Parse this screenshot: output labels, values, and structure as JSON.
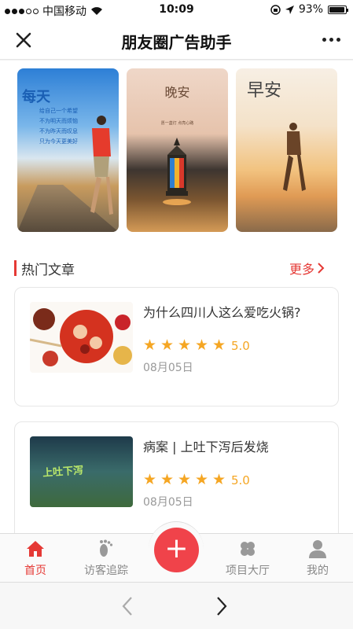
{
  "status": {
    "carrier": "中国移动",
    "time": "10:09",
    "battery": "93%",
    "battery_fraction": 0.93
  },
  "header": {
    "title": "朋友圈广告助手"
  },
  "posters": [
    {
      "name": "poster-morning-run",
      "big": "每天",
      "lines": [
        "给自己一个希望",
        "不为明天而烦恼",
        "不为昨天而叹息",
        "只为今天更美好"
      ]
    },
    {
      "name": "poster-good-night",
      "title": "晚安",
      "sub": "愿一盏灯 点亮心路"
    },
    {
      "name": "poster-good-morning",
      "title": "早安"
    }
  ],
  "section": {
    "title": "热门文章",
    "more": "更多"
  },
  "articles": [
    {
      "title": "为什么四川人这么爱吃火锅?",
      "rating": "5.0",
      "stars": 5,
      "date": "08月05日"
    },
    {
      "title": "病案 | 上吐下泻后发烧",
      "rating": "5.0",
      "stars": 5,
      "date": "08月05日",
      "thumb_text": "上吐下泻"
    }
  ],
  "tabs": [
    {
      "label": "首页",
      "icon": "home-icon",
      "active": true
    },
    {
      "label": "访客追踪",
      "icon": "footprint-icon"
    },
    {
      "label": "项目大厅",
      "icon": "clover-icon"
    },
    {
      "label": "我的",
      "icon": "person-icon"
    }
  ],
  "colors": {
    "accent": "#e53935",
    "star": "#f5a623",
    "fab": "#f0434a"
  }
}
